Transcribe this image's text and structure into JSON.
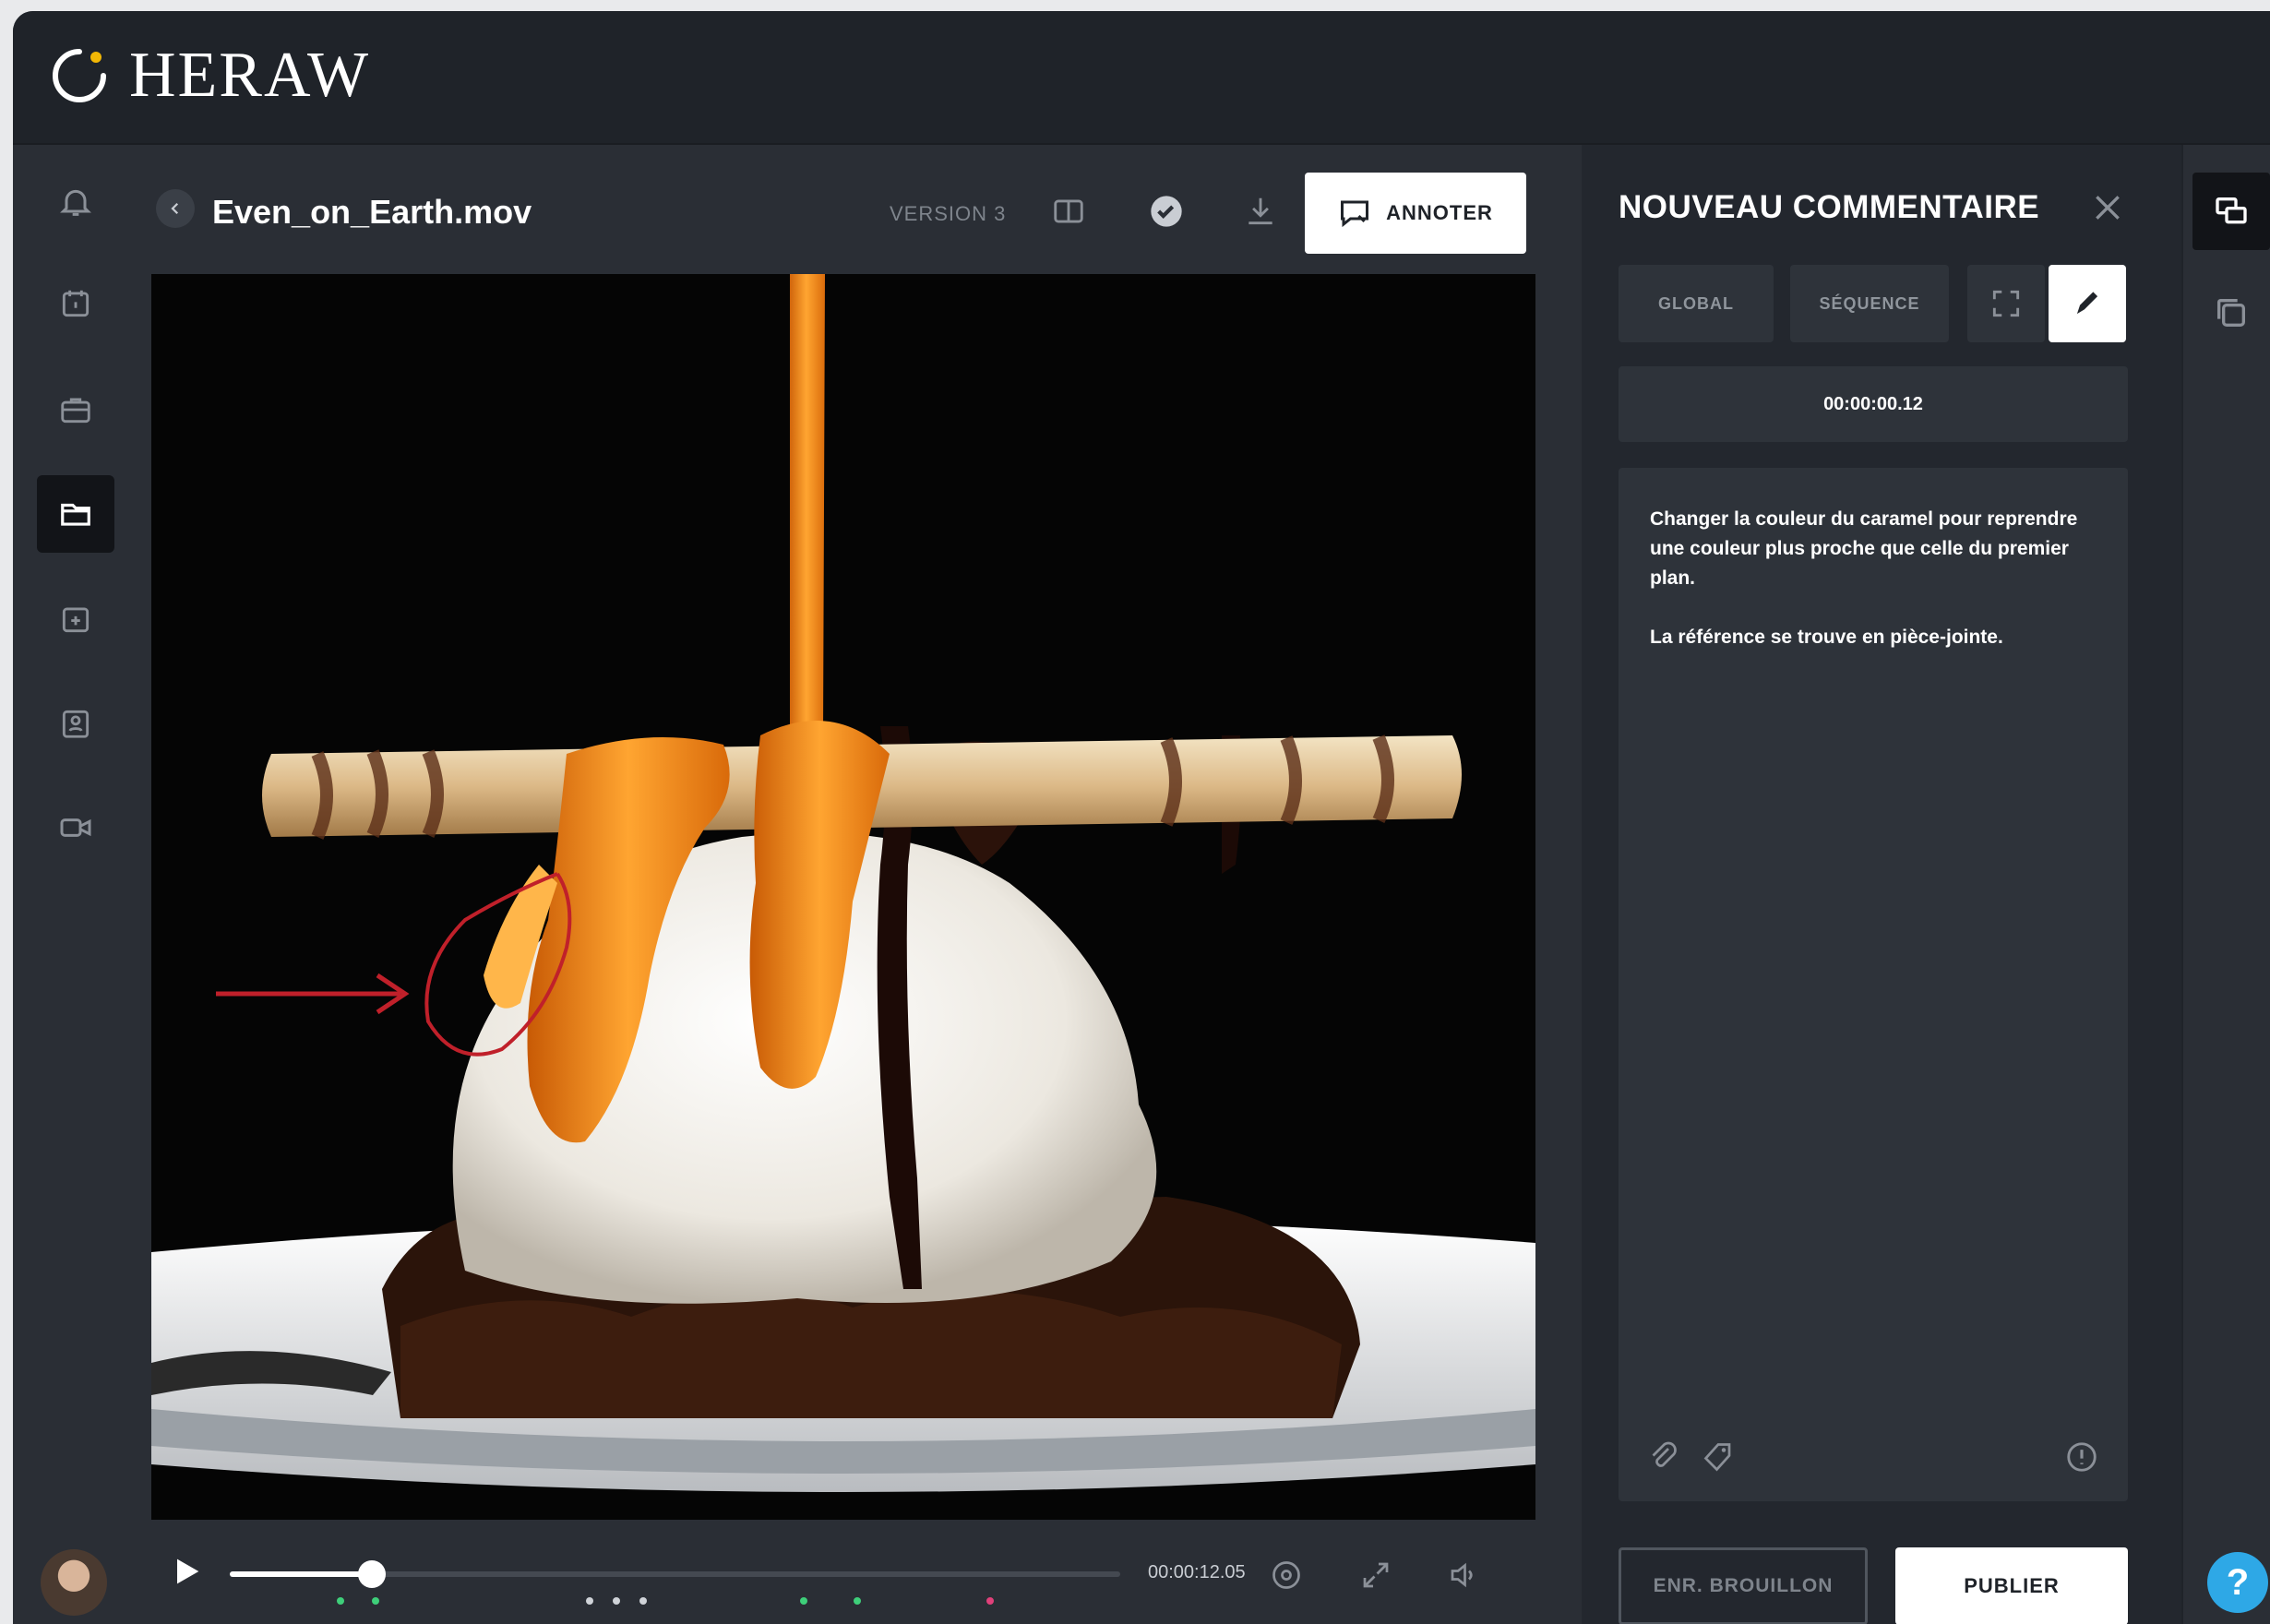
{
  "app": {
    "logo_text": "HERAW"
  },
  "viewer": {
    "filename": "Even_on_Earth.mov",
    "version_label": "VERSION 3",
    "annotate_label": "ANNOTER",
    "timecode": "00:00:12.05",
    "progress_fraction": 0.16,
    "marker_colors": [
      "#3ecf7a",
      "#3ecf7a",
      "#cfd3d8",
      "#cfd3d8",
      "#cfd3d8",
      "#3ecf7a",
      "#3ecf7a",
      "#e0407a"
    ]
  },
  "panel": {
    "title": "NOUVEAU COMMENTAIRE",
    "tabs": [
      {
        "label": "GLOBAL"
      },
      {
        "label": "SÉQUENCE"
      }
    ],
    "timecode": "00:00:00.12",
    "comment_text": "Changer la couleur du caramel pour reprendre une couleur plus proche que celle du premier plan.\n\nLa référence se trouve en pièce-jointe.",
    "draft_label": "ENR. BROUILLON",
    "publish_label": "PUBLIER"
  },
  "help": {
    "label": "?"
  },
  "colors": {
    "accent_logo": "#f2b705",
    "help": "#2ea8e6",
    "annotation": "#c0202a"
  }
}
